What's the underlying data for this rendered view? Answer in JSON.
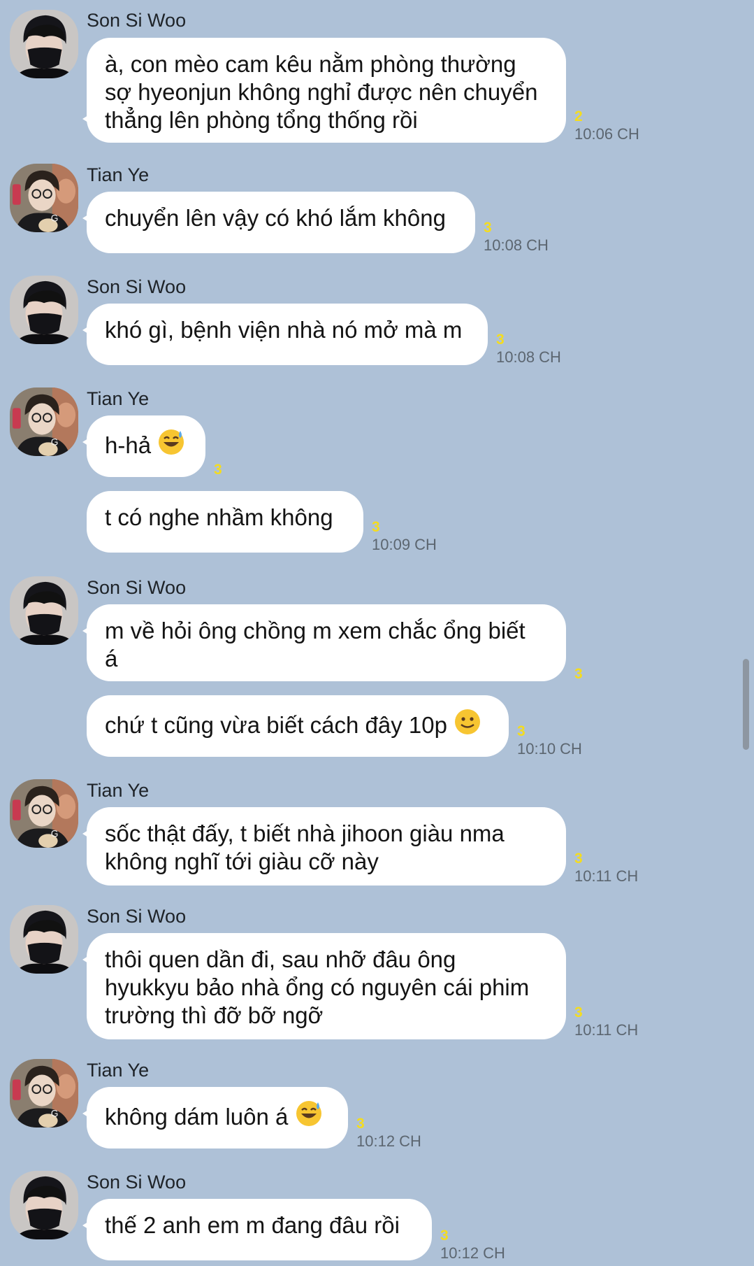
{
  "chat": {
    "senders": {
      "a": "Son Si Woo",
      "b": "Tian Ye"
    },
    "messages": [
      {
        "text": "à, con mèo cam kêu nằm phòng thường\nsợ hyeonjun không nghỉ được nên chuyển\nthẳng lên phòng tổng thống rồi",
        "unread": "2",
        "time": "10:06 CH"
      },
      {
        "text": "chuyển lên vậy có khó lắm không",
        "unread": "3",
        "time": "10:08 CH"
      },
      {
        "text": "khó gì, bệnh viện nhà nó mở mà m",
        "unread": "3",
        "time": "10:08 CH"
      },
      {
        "text": "h-hả",
        "unread": "3",
        "time": ""
      },
      {
        "text": "t có nghe nhầm không",
        "unread": "3",
        "time": "10:09 CH"
      },
      {
        "text": "m về hỏi ông chồng m xem chắc ổng biết\ná",
        "unread": "3",
        "time": ""
      },
      {
        "text": "chứ t cũng vừa biết cách đây 10p",
        "unread": "3",
        "time": "10:10 CH"
      },
      {
        "text": "sốc thật đấy, t biết nhà jihoon giàu nma\nkhông nghĩ tới giàu cỡ này",
        "unread": "3",
        "time": "10:11 CH"
      },
      {
        "text": "thôi quen dần đi, sau nhỡ đâu ông\nhyukkyu bảo nhà ổng có nguyên cái phim\ntrường thì đỡ bỡ ngỡ",
        "unread": "3",
        "time": "10:11 CH"
      },
      {
        "text": "không dám luôn á",
        "unread": "3",
        "time": "10:12 CH"
      },
      {
        "text": "thế 2 anh em m đang đâu rồi",
        "unread": "3",
        "time": "10:12 CH"
      }
    ],
    "emojis": {
      "sweat_smile": "sweat-smile-emoji",
      "slight_smile": "slight-smile-emoji"
    }
  },
  "colors": {
    "background": "#aec1d7",
    "bubble": "#ffffff",
    "unread": "#f4dc1f",
    "time": "#5c6670"
  }
}
